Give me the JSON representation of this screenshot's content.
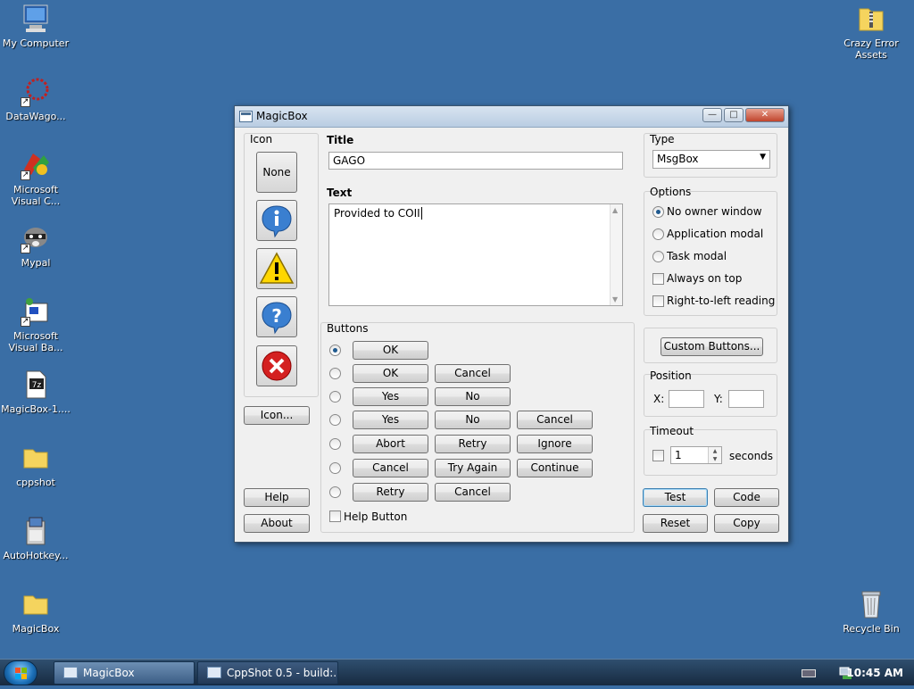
{
  "desktop": {
    "icons": [
      {
        "label": "My Computer"
      },
      {
        "label": "DataWago..."
      },
      {
        "label": "Microsoft Visual C..."
      },
      {
        "label": "Mypal"
      },
      {
        "label": "Microsoft Visual Ba..."
      },
      {
        "label": "MagicBox-1...."
      },
      {
        "label": "cppshot"
      },
      {
        "label": "AutoHotkey..."
      },
      {
        "label": "MagicBox"
      },
      {
        "label": "Crazy Error Assets"
      },
      {
        "label": "Recycle Bin"
      }
    ]
  },
  "window": {
    "title": "MagicBox",
    "icon_group": {
      "label": "Icon",
      "none_label": "None",
      "icons": [
        "info-icon",
        "warning-icon",
        "question-icon",
        "error-icon"
      ],
      "icon_button_label": "Icon...",
      "help_label": "Help",
      "about_label": "About"
    },
    "title_field": {
      "label": "Title",
      "value": "GAGO"
    },
    "text_field": {
      "label": "Text",
      "value": "Provided to COII"
    },
    "type": {
      "label": "Type",
      "selected": "MsgBox"
    },
    "options": {
      "label": "Options",
      "radios": [
        {
          "label": "No owner window",
          "checked": true
        },
        {
          "label": "Application modal",
          "checked": false
        },
        {
          "label": "Task modal",
          "checked": false
        }
      ],
      "checks": [
        {
          "label": "Always on top",
          "checked": false
        },
        {
          "label": "Right-to-left reading",
          "checked": false
        }
      ]
    },
    "buttons_group": {
      "label": "Buttons",
      "rows": [
        {
          "checked": true,
          "labels": [
            "OK"
          ]
        },
        {
          "checked": false,
          "labels": [
            "OK",
            "Cancel"
          ]
        },
        {
          "checked": false,
          "labels": [
            "Yes",
            "No"
          ]
        },
        {
          "checked": false,
          "labels": [
            "Yes",
            "No",
            "Cancel"
          ]
        },
        {
          "checked": false,
          "labels": [
            "Abort",
            "Retry",
            "Ignore"
          ]
        },
        {
          "checked": false,
          "labels": [
            "Cancel",
            "Try Again",
            "Continue"
          ]
        },
        {
          "checked": false,
          "labels": [
            "Retry",
            "Cancel"
          ]
        }
      ],
      "help_button_label": "Help Button"
    },
    "custom_buttons_label": "Custom Buttons...",
    "position": {
      "label": "Position",
      "x_label": "X:",
      "y_label": "Y:",
      "x_value": "",
      "y_value": ""
    },
    "timeout": {
      "label": "Timeout",
      "value": "1",
      "unit": "seconds"
    },
    "actions": {
      "test": "Test",
      "code": "Code",
      "reset": "Reset",
      "copy": "Copy"
    }
  },
  "taskbar": {
    "tasks": [
      {
        "label": "MagicBox"
      },
      {
        "label": "CppShot 0.5 - build:..."
      }
    ],
    "clock": "10:45 AM"
  }
}
